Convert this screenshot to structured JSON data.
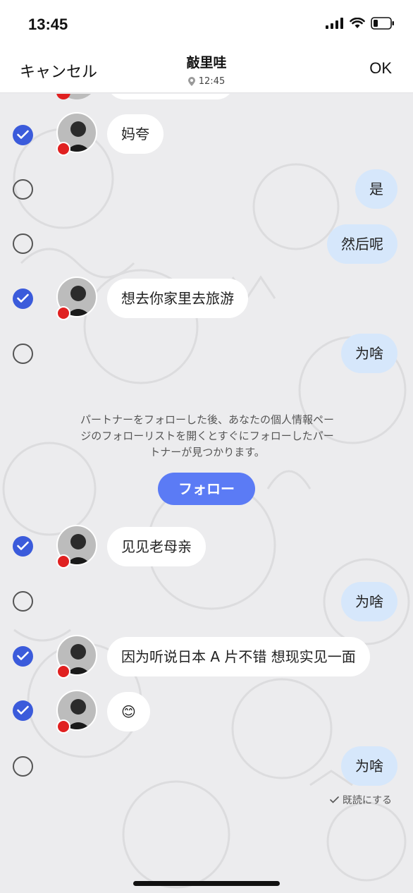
{
  "status_bar": {
    "time": "13:45"
  },
  "header": {
    "cancel_label": "キャンセル",
    "title": "敲里哇",
    "subtitle_time": "12:45",
    "ok_label": "OK"
  },
  "messages": [
    {
      "dir": "in",
      "text": "妈夸",
      "checked": true
    },
    {
      "dir": "out",
      "text": "是",
      "checked": false
    },
    {
      "dir": "out",
      "text": "然后呢",
      "checked": false
    },
    {
      "dir": "in",
      "text": "想去你家里去旅游",
      "checked": true
    },
    {
      "dir": "out",
      "text": "为啥",
      "checked": false
    },
    {
      "dir": "in",
      "text": "见见老母亲",
      "checked": true
    },
    {
      "dir": "out",
      "text": "为啥",
      "checked": false
    },
    {
      "dir": "in",
      "text": "因为听说日本 A 片不错 想现实见一面",
      "checked": true
    },
    {
      "dir": "in",
      "text": "😊",
      "checked": true
    },
    {
      "dir": "out",
      "text": "为啥",
      "checked": false
    }
  ],
  "notice": {
    "line1": "パートナーをフォローした後、あなたの個人情報ペー",
    "line2": "ジのフォローリストを開くとすぐにフォローしたパー",
    "line3": "トナーが見つかります。",
    "follow_label": "フォロー"
  },
  "read_status": "既読にする",
  "colors": {
    "checkbox_on": "#3b5bdb",
    "outgoing_bubble": "#d6e7fb",
    "follow_button": "#5b7bf5",
    "flag": "#e02020"
  }
}
